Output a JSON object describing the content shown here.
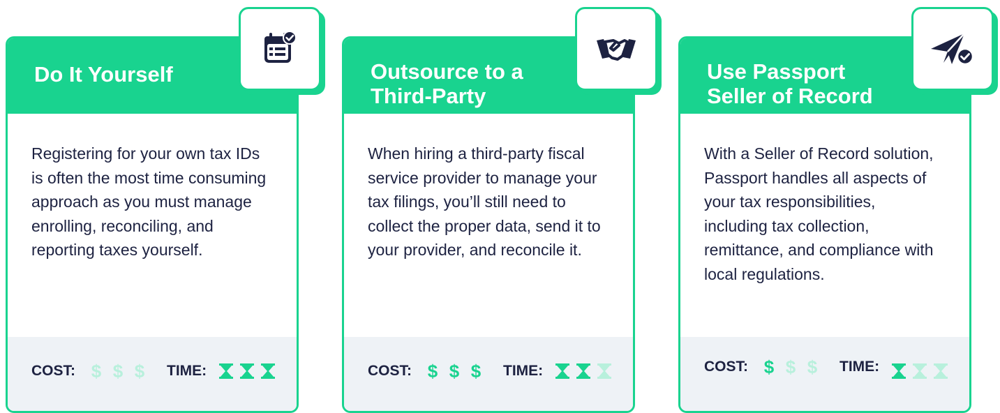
{
  "colors": {
    "brand_green": "#19d38f",
    "light_green": "#b8f0dc",
    "navy": "#1d2241",
    "footer_bg": "#eef2f6"
  },
  "cards": [
    {
      "title": "Do It Yourself",
      "icon": "calendar-check-icon",
      "body": "Registering for your own tax IDs is often the most time consuming approach as you must manage enrolling, reconciling, and reporting taxes yourself.",
      "cost_label": "COST:",
      "time_label": "TIME:",
      "cost_level": 0,
      "time_level": 3
    },
    {
      "title": "Outsource to a\nThird-Party",
      "icon": "handshake-icon",
      "body": "When hiring a third-party fiscal service provider to manage your tax filings, you’ll still need to collect the proper data, send it to your provider, and reconcile it.",
      "cost_label": "COST:",
      "time_label": "TIME:",
      "cost_level": 3,
      "time_level": 2
    },
    {
      "title": "Use Passport\nSeller of Record",
      "icon": "paper-plane-check-icon",
      "body": "With a Seller of Record solution, Passport handles all aspects of your tax responsibilities, including tax collection, remittance, and compliance with local regulations.",
      "cost_label": "COST:",
      "time_label": "TIME:",
      "cost_level": 1,
      "time_level": 1
    }
  ],
  "dollar_symbol": "$"
}
